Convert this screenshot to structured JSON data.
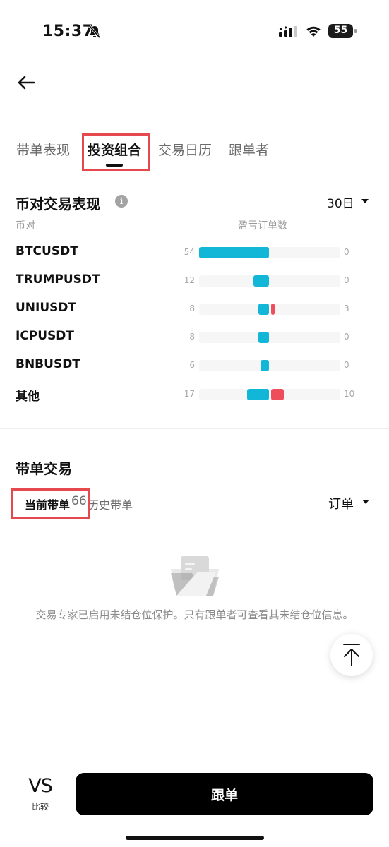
{
  "status_bar": {
    "time": "15:37",
    "battery": "55"
  },
  "tabs": [
    {
      "label": "带单表现",
      "active": false
    },
    {
      "label": "投资组合",
      "active": true
    },
    {
      "label": "交易日历",
      "active": false
    },
    {
      "label": "跟单者",
      "active": false
    }
  ],
  "pair_performance": {
    "title": "币对交易表现",
    "period": "30日",
    "col_pair": "币对",
    "col_orders": "盈亏订单数",
    "rows": [
      {
        "pair": "BTCUSDT",
        "wins": 54,
        "losses": 0
      },
      {
        "pair": "TRUMPUSDT",
        "wins": 12,
        "losses": 0
      },
      {
        "pair": "UNIUSDT",
        "wins": 8,
        "losses": 3
      },
      {
        "pair": "ICPUSDT",
        "wins": 8,
        "losses": 0
      },
      {
        "pair": "BNBUSDT",
        "wins": 6,
        "losses": 0
      },
      {
        "pair": "其他",
        "wins": 17,
        "losses": 10
      }
    ],
    "colors": {
      "win": "#12b6d6",
      "loss": "#ee4d5c"
    }
  },
  "lead_trades": {
    "title": "带单交易",
    "current_tab": "当前带单",
    "current_count": "66",
    "history_tab": "历史带单",
    "filter": "订单",
    "empty_message": "交易专家已启用未结仓位保护。只有跟单者可查看其未结仓位信息。"
  },
  "bottom_bar": {
    "vs_label": "VS",
    "compare_label": "比较",
    "follow_label": "跟单"
  },
  "annotation_color": "#e5484d"
}
